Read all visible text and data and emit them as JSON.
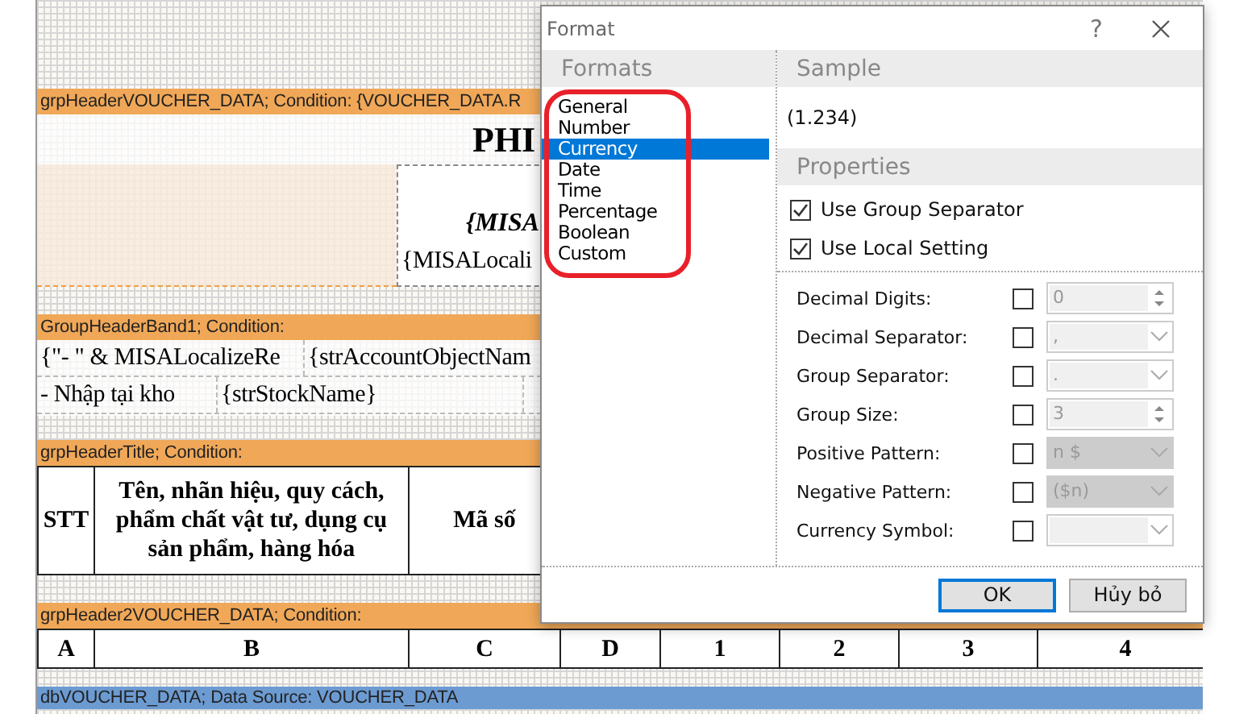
{
  "report": {
    "bands": [
      {
        "kind": "header",
        "label": "grpHeaderVOUCHER_DATA; Condition: {VOUCHER_DATA.R",
        "title": "PHI",
        "subtitle": "{MISA",
        "line": "{MISALocali"
      },
      {
        "kind": "fields",
        "label": "GroupHeaderBand1; Condition:",
        "rows": [
          [
            "{\"- \" & MISALocalizeRe",
            "{strAccountObjectNam"
          ],
          [
            "- Nhập tại kho",
            "{strStockName}"
          ]
        ]
      },
      {
        "kind": "table",
        "label": "grpHeaderTitle; Condition:",
        "cells": [
          "STT",
          "Tên, nhãn hiệu, quy cách, phẩm chất vật tư, dụng cụ sản phẩm, hàng hóa",
          "Mã số"
        ]
      },
      {
        "kind": "row",
        "label": "grpHeader2VOUCHER_DATA; Condition:",
        "cells": [
          "A",
          "B",
          "C",
          "D",
          "1",
          "2",
          "3",
          "4"
        ]
      },
      {
        "kind": "data",
        "label": "dbVOUCHER_DATA; Data Source: VOUCHER_DATA"
      }
    ]
  },
  "dialog": {
    "title": "Format",
    "help": "?",
    "formats_header": "Formats",
    "formats": [
      {
        "label": "General",
        "selected": false
      },
      {
        "label": "Number",
        "selected": false
      },
      {
        "label": "Currency",
        "selected": true
      },
      {
        "label": "Date",
        "selected": false
      },
      {
        "label": "Time",
        "selected": false
      },
      {
        "label": "Percentage",
        "selected": false
      },
      {
        "label": "Boolean",
        "selected": false
      },
      {
        "label": "Custom",
        "selected": false
      }
    ],
    "sample_header": "Sample",
    "sample": "(1.234)",
    "properties_header": "Properties",
    "options": [
      {
        "label": "Use Group Separator",
        "checked": true
      },
      {
        "label": "Use Local Setting",
        "checked": true
      }
    ],
    "fields": [
      {
        "label": "Decimal Digits:",
        "checked": false,
        "kind": "spin",
        "value": "0",
        "disabled": false
      },
      {
        "label": "Decimal Separator:",
        "checked": false,
        "kind": "combo",
        "value": ",",
        "disabled": false
      },
      {
        "label": "Group Separator:",
        "checked": false,
        "kind": "combo",
        "value": ".",
        "disabled": false
      },
      {
        "label": "Group Size:",
        "checked": false,
        "kind": "spin",
        "value": "3",
        "disabled": false
      },
      {
        "label": "Positive Pattern:",
        "checked": false,
        "kind": "combo",
        "value": "n $",
        "disabled": true
      },
      {
        "label": "Negative Pattern:",
        "checked": false,
        "kind": "combo",
        "value": "($n)",
        "disabled": true
      },
      {
        "label": "Currency Symbol:",
        "checked": false,
        "kind": "combo",
        "disabled": false
      }
    ],
    "buttons": [
      {
        "label": "OK",
        "default": true
      },
      {
        "label": "Hủy bỏ",
        "default": false
      }
    ]
  }
}
